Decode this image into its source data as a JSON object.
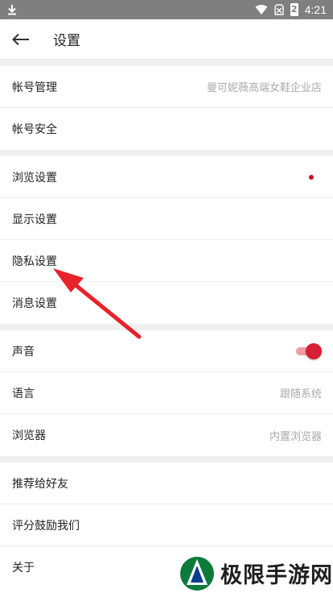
{
  "status_bar": {
    "time": "4:21",
    "battery_level": "2"
  },
  "header": {
    "title": "设置"
  },
  "groups": [
    {
      "rows": [
        {
          "label": "帐号管理",
          "value": "曼可妮薇高端女鞋企业店"
        },
        {
          "label": "帐号安全"
        }
      ]
    },
    {
      "rows": [
        {
          "label": "浏览设置",
          "badge": "red-dot"
        },
        {
          "label": "显示设置"
        },
        {
          "label": "隐私设置"
        },
        {
          "label": "消息设置"
        }
      ]
    },
    {
      "rows": [
        {
          "label": "声音",
          "toggle_on": true
        },
        {
          "label": "语言",
          "value": "跟随系统"
        },
        {
          "label": "浏览器",
          "value": "内置浏览器"
        }
      ]
    },
    {
      "rows": [
        {
          "label": "推荐给好友"
        },
        {
          "label": "评分鼓励我们"
        },
        {
          "label": "关于"
        }
      ]
    }
  ],
  "watermark": {
    "text": "极限手游网"
  },
  "colors": {
    "accent": "#d71f35",
    "status_bar": "#7f7f7f",
    "annotation_arrow": "#e8222a"
  }
}
